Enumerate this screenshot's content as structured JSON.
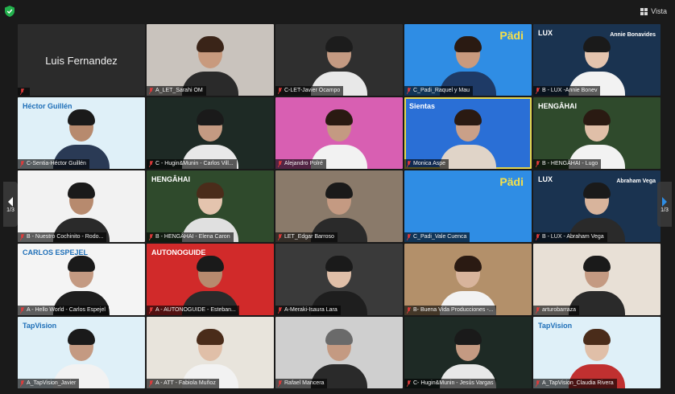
{
  "toolbar": {
    "view_label": "Vista"
  },
  "pager": {
    "left_label": "1/3",
    "right_label": "1/3"
  },
  "tiles": [
    {
      "name": "",
      "center_name": "Luis Fernandez",
      "bg": "#2b2b2b"
    },
    {
      "name": "A_LET_Sarahi OM",
      "bg": "#c9c3bd",
      "skin": "#c89a7e",
      "hair": "#3a2418",
      "shirt": "#2a2a2a"
    },
    {
      "name": "C-LET-Javier Ocampo",
      "bg": "#2f2f2f",
      "skin": "#c49a82",
      "hair": "#1c1c1c",
      "shirt": "#e8e8e8"
    },
    {
      "name": "C_Padi_Raquel y Mau",
      "bg": "#2f8de4",
      "logo": "Pädi",
      "skin": "#c99a7e",
      "hair": "#2a1a12",
      "shirt": "#1e3a66"
    },
    {
      "name": "B - LUX -Annie Bonev",
      "bg": "#1a3350",
      "logo": "LUX",
      "sub": "Annie Bonavides",
      "skin": "#e4c4ae",
      "hair": "#1a1a1a",
      "shirt": "#f2f2f2"
    },
    {
      "name": "C-Sentia-Héctor Guillén",
      "bg": "#dff0f8",
      "logo": "Héctor Guillén",
      "skin": "#b78a6e",
      "hair": "#1a1a1a",
      "shirt": "#2a3a55"
    },
    {
      "name": "C - Hugin&Munin - Carlos Vill...",
      "bg": "#1e2a25",
      "skin": "#c49a82",
      "hair": "#1a1a1a",
      "shirt": "#e8e8e8"
    },
    {
      "name": "Alejandro Polré",
      "bg": "#d85fb2",
      "skin": "#c49a82",
      "hair": "#2a1a12",
      "shirt": "#f2f2f2"
    },
    {
      "name": "Monica Aspe",
      "bg": "#2a6fd6",
      "logo": "Sientas",
      "skin": "#caa088",
      "hair": "#2a1a12",
      "shirt": "#e0d4c8",
      "active": true
    },
    {
      "name": "B - HENGÂHAI - Lugo",
      "bg": "#2f4a2c",
      "logo": "HENGÂHAI",
      "skin": "#e0bfa8",
      "hair": "#2a1a12",
      "shirt": "#f2f2f2"
    },
    {
      "name": "B - Nuestro Cochinito - Rodo...",
      "bg": "#f2f2f2",
      "skin": "#b78a6e",
      "hair": "#1a1a1a",
      "shirt": "#2a2a2a"
    },
    {
      "name": "B - HENGÂHAI - Elena Caron",
      "bg": "#2f4a2c",
      "logo": "HENGÂHAI",
      "skin": "#e4c4ae",
      "hair": "#4a2c1a",
      "shirt": "#e0e0e0"
    },
    {
      "name": "LET_Edgar Barroso",
      "bg": "#8a7a6a",
      "skin": "#c49a82",
      "hair": "#1a1a1a",
      "shirt": "#2a2a2a"
    },
    {
      "name": "C_Padi_Vale Cuenca",
      "bg": "#2f8de4",
      "logo": "Pädi",
      "noperson": true
    },
    {
      "name": "B - LUX - Abraham Vega",
      "bg": "#1a3350",
      "logo": "LUX",
      "sub": "Abraham Vega",
      "skin": "#d8b49c",
      "hair": "#1a1a1a",
      "shirt": "#2a2a2a"
    },
    {
      "name": "A - Hello World - Carlos Espejel",
      "bg": "#f4f4f4",
      "logo": "CARLOS ESPEJEL",
      "skin": "#c49a82",
      "hair": "#1a1a1a",
      "shirt": "#1e1e1e"
    },
    {
      "name": "A - AUTONOGUIDE - Esteban...",
      "bg": "#d12a2a",
      "logo": "AUTONOGUIDE",
      "skin": "#b78a6e",
      "hair": "#1a1a1a",
      "shirt": "#2a2a2a"
    },
    {
      "name": "A-Meraki-Isaura Lara",
      "bg": "#3a3a3a",
      "skin": "#e0bfa8",
      "hair": "#1a1a1a",
      "shirt": "#1e1e1e"
    },
    {
      "name": "B- Buena Vida Producciones -...",
      "bg": "#b3906a",
      "skin": "#d8b49c",
      "hair": "#2a1a12",
      "shirt": "#f2f2f2"
    },
    {
      "name": "arturobarraza",
      "bg": "#e8e0d6",
      "skin": "#c49a82",
      "hair": "#1a1a1a",
      "shirt": "#2a2a2a"
    },
    {
      "name": "A_TapVision_Javier",
      "bg": "#dff0f8",
      "logo": "TapVision",
      "skin": "#c49a82",
      "hair": "#1a1a1a",
      "shirt": "#f2f2f2"
    },
    {
      "name": "A - ATT - Fabiola Muñoz",
      "bg": "#e8e4dc",
      "skin": "#e0bfa8",
      "hair": "#4a2c1a",
      "shirt": "#f2f2f2"
    },
    {
      "name": "Rafael Mancera",
      "bg": "#cfcfcf",
      "skin": "#c49a82",
      "hair": "#6a6a6a",
      "shirt": "#2a2a2a"
    },
    {
      "name": "C- Hugin&Munin - Jesús Vargas",
      "bg": "#1e2a25",
      "skin": "#c49a82",
      "hair": "#1a1a1a",
      "shirt": "#e8e8e8"
    },
    {
      "name": "A_TapVision_Claudia Rivera",
      "bg": "#dff0f8",
      "logo": "TapVision",
      "skin": "#e0bfa8",
      "hair": "#4a2c1a",
      "shirt": "#c03030"
    }
  ]
}
